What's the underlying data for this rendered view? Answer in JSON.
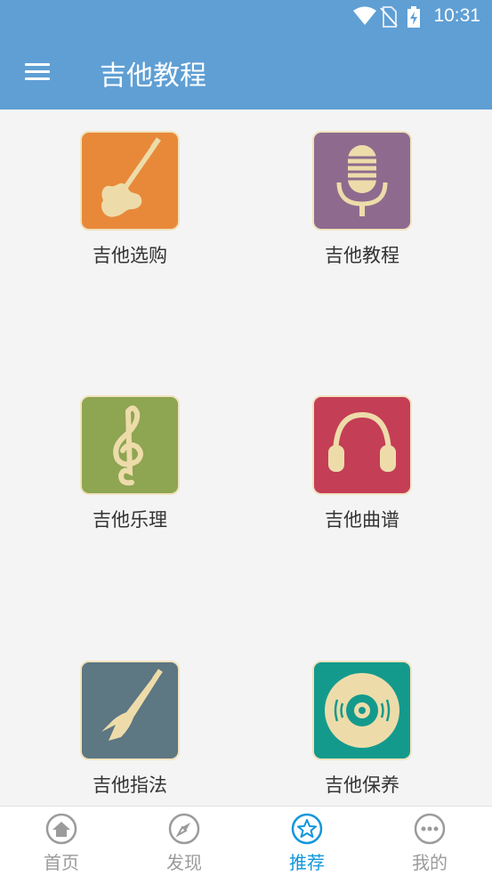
{
  "status_bar": {
    "time": "10:31",
    "icons": [
      "wifi-icon",
      "no-sim-icon",
      "battery-charging-icon"
    ]
  },
  "app_bar": {
    "title": "吉他教程",
    "menu_icon": "menu-icon"
  },
  "tiles": [
    {
      "label": "吉他选购",
      "icon": "electric-guitar-icon",
      "color": "#e8893a"
    },
    {
      "label": "吉他教程",
      "icon": "microphone-icon",
      "color": "#8e6b8e"
    },
    {
      "label": "吉他乐理",
      "icon": "treble-clef-icon",
      "color": "#8ea552"
    },
    {
      "label": "吉他曲谱",
      "icon": "headphones-icon",
      "color": "#c43e56"
    },
    {
      "label": "吉他指法",
      "icon": "bass-guitar-icon",
      "color": "#5d7783"
    },
    {
      "label": "吉他保养",
      "icon": "vinyl-record-icon",
      "color": "#149a8c"
    }
  ],
  "bottom_nav": [
    {
      "label": "首页",
      "icon": "home-icon",
      "active": false
    },
    {
      "label": "发现",
      "icon": "compass-icon",
      "active": false
    },
    {
      "label": "推荐",
      "icon": "star-icon",
      "active": true
    },
    {
      "label": "我的",
      "icon": "more-icon",
      "active": false
    }
  ],
  "colors": {
    "app_bar": "#5f9fd4",
    "active_nav": "#1296db",
    "inactive_nav": "#9b9b9b",
    "icon_cream": "#eddcaa"
  }
}
